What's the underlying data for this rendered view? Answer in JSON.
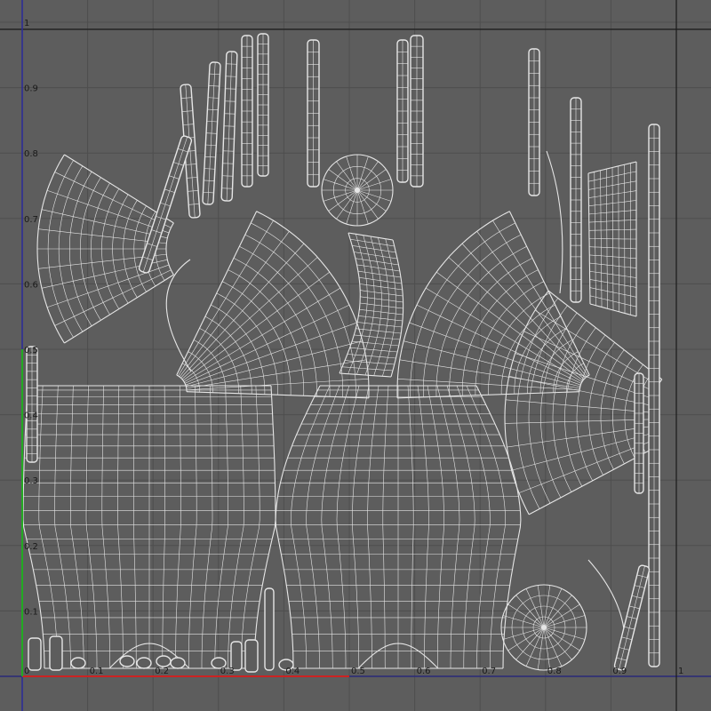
{
  "editor": {
    "view": "UV Texture Editor",
    "grid": true,
    "background_color": "#5d5d5d",
    "wire_color": "#e6e6e6",
    "axis_u_color": "#cc2222",
    "axis_v_color": "#22aa22",
    "border_color": "#1a1a1a"
  },
  "axis": {
    "u_ticks": [
      "0",
      "0.1",
      "0.2",
      "0.3",
      "0.4",
      "0.5",
      "0.6",
      "0.7",
      "0.8",
      "0.9",
      "1"
    ],
    "v_ticks": [
      "0.1",
      "0.2",
      "0.3",
      "0.4",
      "0.5",
      "0.6",
      "0.7",
      "0.8",
      "0.9",
      "1"
    ]
  },
  "islands": [
    {
      "name": "left-top-fan",
      "type": "fan-patch"
    },
    {
      "name": "center-top-fan",
      "type": "fan-patch"
    },
    {
      "name": "right-top-fan",
      "type": "fan-patch"
    },
    {
      "name": "right-mid-fan",
      "type": "fan-patch"
    },
    {
      "name": "left-pot-body",
      "type": "pot-body"
    },
    {
      "name": "center-pot-body",
      "type": "pot-body"
    },
    {
      "name": "top-disc",
      "type": "radial-disc"
    },
    {
      "name": "bottom-disc",
      "type": "radial-disc"
    },
    {
      "name": "center-curved-strip",
      "type": "curved-grid"
    },
    {
      "name": "right-curved-strip",
      "type": "curved-grid"
    },
    {
      "name": "vertical-strips",
      "type": "strip-set"
    },
    {
      "name": "bottom-small-pieces",
      "type": "small-pieces"
    }
  ]
}
